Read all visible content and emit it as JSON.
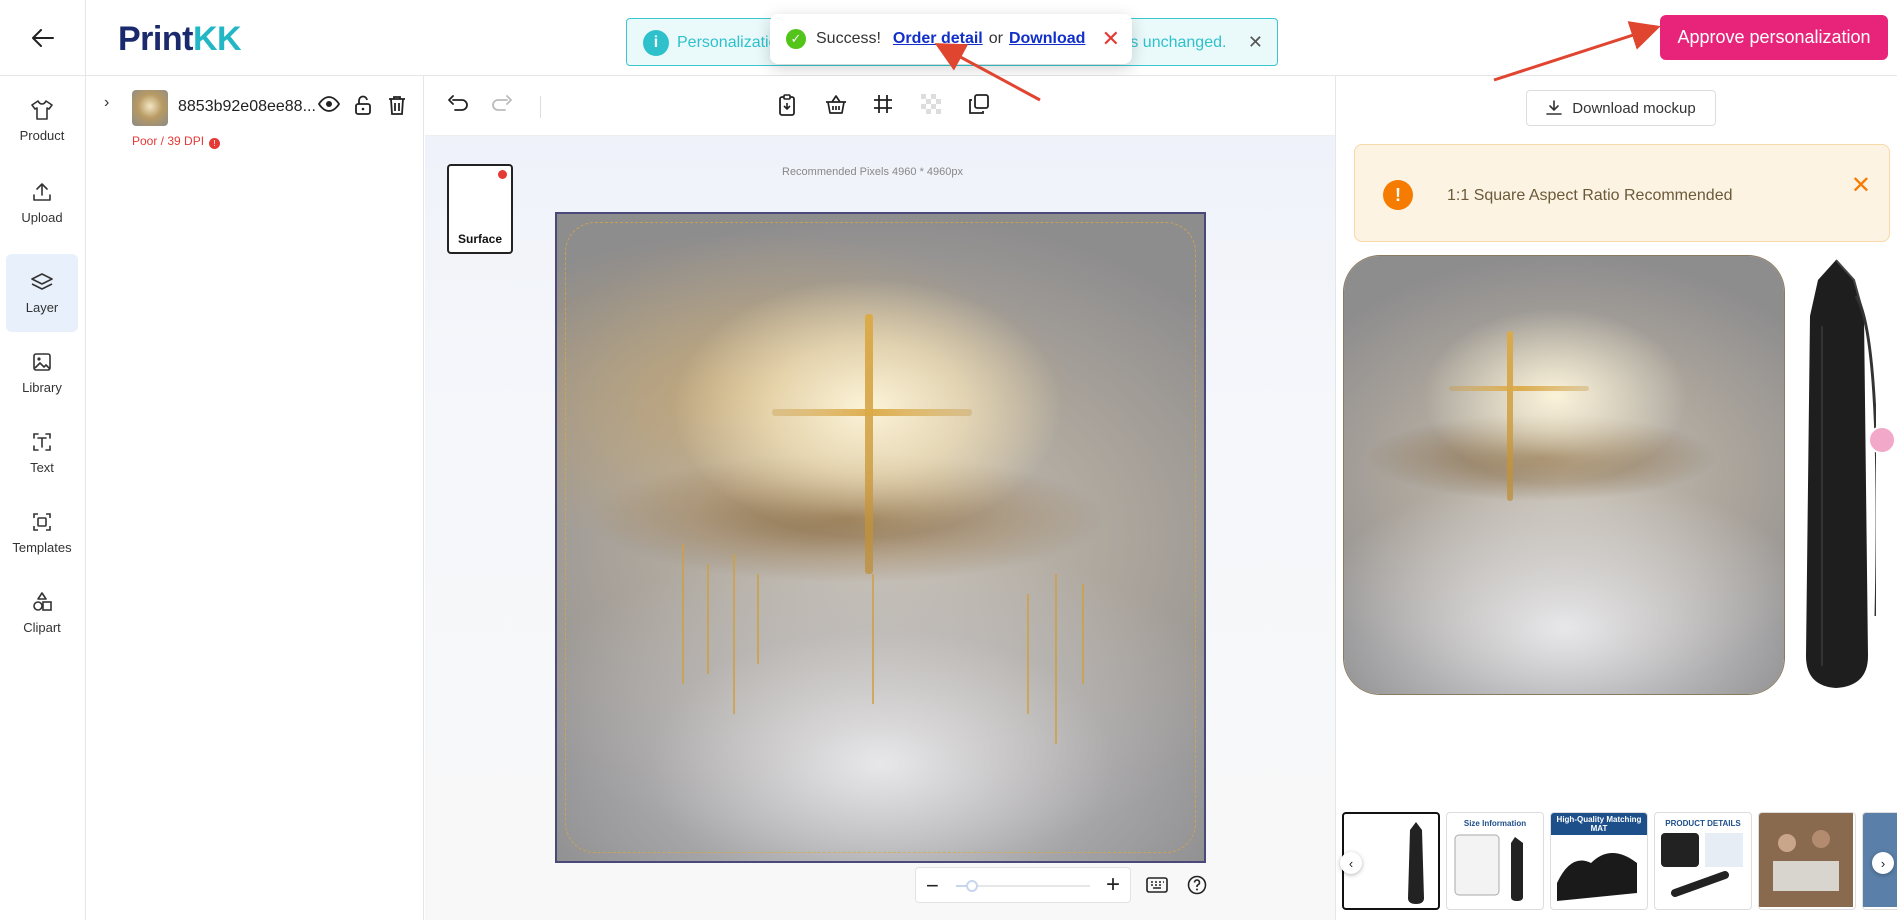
{
  "header": {
    "logo_part1": "Print",
    "logo_part2": "KK",
    "info_banner": {
      "text_left": "Personalizatio",
      "text_right": "ains unchanged."
    },
    "toast": {
      "status": "Success!",
      "order_link": "Order detail",
      "or": "or",
      "download_link": "Download"
    },
    "approve_label": "Approve personalization"
  },
  "nav": {
    "items": [
      {
        "label": "Product",
        "icon": "tshirt-icon"
      },
      {
        "label": "Upload",
        "icon": "upload-icon"
      },
      {
        "label": "Layer",
        "icon": "layers-icon"
      },
      {
        "label": "Library",
        "icon": "image-icon"
      },
      {
        "label": "Text",
        "icon": "text-icon"
      },
      {
        "label": "Templates",
        "icon": "templates-icon"
      },
      {
        "label": "Clipart",
        "icon": "shapes-icon"
      }
    ],
    "active": "Layer"
  },
  "layer": {
    "name": "8853b92e08ee88...",
    "dpi_text": "Poor / 39 DPI"
  },
  "canvas": {
    "surface_label": "Surface",
    "recommended": "Recommended Pixels 4960 * 4960px",
    "zoom_level": 0.12
  },
  "right": {
    "download_mockup": "Download mockup",
    "warning": "1:1 Square Aspect Ratio Recommended",
    "thumbnails": [
      {
        "label": "",
        "selected": true
      },
      {
        "label": "Size Information",
        "selected": false
      },
      {
        "label": "High-Quality Matching MAT",
        "selected": false
      },
      {
        "label": "PRODUCT DETAILS",
        "selected": false
      },
      {
        "label": "",
        "selected": false
      },
      {
        "label": "",
        "selected": false
      }
    ]
  },
  "colors": {
    "accent": "#e8247a",
    "teal": "#2ec1cc",
    "warning": "#f57c00",
    "error": "#e53935",
    "success": "#52c41a",
    "link": "#1230c9"
  }
}
